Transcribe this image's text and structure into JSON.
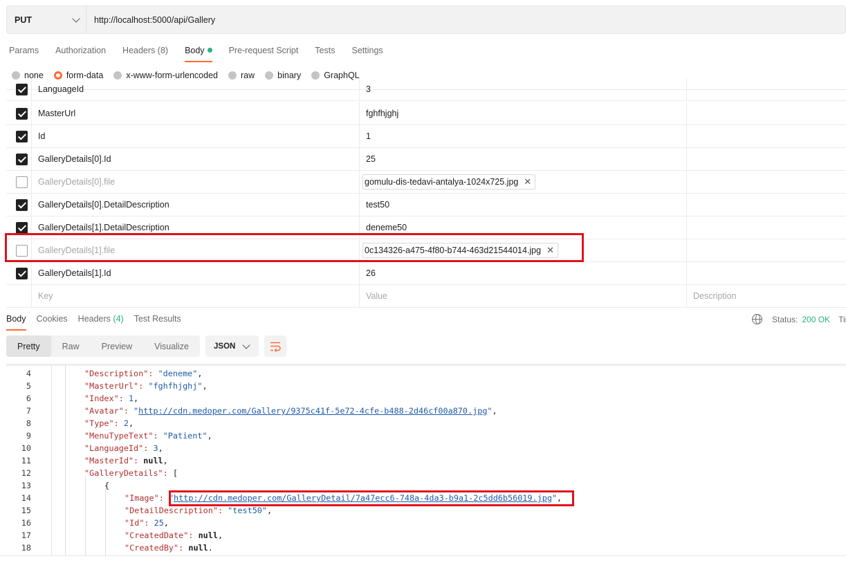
{
  "request": {
    "method": "PUT",
    "url": "http://localhost:5000/api/Gallery"
  },
  "request_tabs": [
    {
      "label": "Params"
    },
    {
      "label": "Authorization"
    },
    {
      "label": "Headers",
      "count": "(8)"
    },
    {
      "label": "Body"
    },
    {
      "label": "Pre-request Script"
    },
    {
      "label": "Tests"
    },
    {
      "label": "Settings"
    }
  ],
  "active_request_tab": "Body",
  "body_types": [
    "none",
    "form-data",
    "x-www-form-urlencoded",
    "raw",
    "binary",
    "GraphQL"
  ],
  "selected_body_type": "form-data",
  "form_rows": [
    {
      "checked": true,
      "key": "LanguageId",
      "value": "3",
      "type": "text"
    },
    {
      "checked": true,
      "key": "MasterUrl",
      "value": "fghfhjghj",
      "type": "text"
    },
    {
      "checked": true,
      "key": "Id",
      "value": "1",
      "type": "text"
    },
    {
      "checked": true,
      "key": "GalleryDetails[0].Id",
      "value": "25",
      "type": "text"
    },
    {
      "checked": false,
      "key": "GalleryDetails[0].file",
      "value": "gomulu-dis-tedavi-antalya-1024x725.jpg",
      "type": "file"
    },
    {
      "checked": true,
      "key": "GalleryDetails[0].DetailDescription",
      "value": "test50",
      "type": "text"
    },
    {
      "checked": true,
      "key": "GalleryDetails[1].DetailDescription",
      "value": "deneme50",
      "type": "text"
    },
    {
      "checked": false,
      "key": "GalleryDetails[1].file",
      "value": "0c134326-a475-4f80-b744-463d21544014.jpg",
      "type": "file"
    },
    {
      "checked": true,
      "key": "GalleryDetails[1].Id",
      "value": "26",
      "type": "text"
    }
  ],
  "new_row_placeholders": {
    "key": "Key",
    "value": "Value",
    "description": "Description"
  },
  "response_tabs": [
    {
      "label": "Body"
    },
    {
      "label": "Cookies"
    },
    {
      "label": "Headers",
      "count": "(4)"
    },
    {
      "label": "Test Results"
    }
  ],
  "status": {
    "label": "Status:",
    "value": "200 OK",
    "time_label": "Tim"
  },
  "view_modes": [
    "Pretty",
    "Raw",
    "Preview",
    "Visualize"
  ],
  "active_view_mode": "Pretty",
  "format": "JSON",
  "code_lines": [
    {
      "n": "4",
      "indent": 1,
      "key": "Description",
      "value": "deneme",
      "vtype": "string"
    },
    {
      "n": "5",
      "indent": 1,
      "key": "MasterUrl",
      "value": "fghfhjghj",
      "vtype": "string"
    },
    {
      "n": "6",
      "indent": 1,
      "key": "Index",
      "value": "1",
      "vtype": "number"
    },
    {
      "n": "7",
      "indent": 1,
      "key": "Avatar",
      "value": "http://cdn.medoper.com/Gallery/9375c41f-5e72-4cfe-b488-2d46cf00a870.jpg",
      "vtype": "link"
    },
    {
      "n": "8",
      "indent": 1,
      "key": "Type",
      "value": "2",
      "vtype": "number"
    },
    {
      "n": "9",
      "indent": 1,
      "key": "MenuTypeText",
      "value": "Patient",
      "vtype": "string"
    },
    {
      "n": "10",
      "indent": 1,
      "key": "LanguageId",
      "value": "3",
      "vtype": "number"
    },
    {
      "n": "11",
      "indent": 1,
      "key": "MasterId",
      "value": "null",
      "vtype": "keyword"
    },
    {
      "n": "12",
      "indent": 1,
      "key": "GalleryDetails",
      "value": "[",
      "vtype": "open"
    },
    {
      "n": "13",
      "indent": 2,
      "key": "",
      "value": "{",
      "vtype": "brace"
    },
    {
      "n": "14",
      "indent": 3,
      "key": "Image",
      "value": "http://cdn.medoper.com/GalleryDetail/7a47ecc6-748a-4da3-b9a1-2c5dd6b56019.jpg",
      "vtype": "link"
    },
    {
      "n": "15",
      "indent": 3,
      "key": "DetailDescription",
      "value": "test50",
      "vtype": "string"
    },
    {
      "n": "16",
      "indent": 3,
      "key": "Id",
      "value": "25",
      "vtype": "number"
    },
    {
      "n": "17",
      "indent": 3,
      "key": "CreatedDate",
      "value": "null",
      "vtype": "keyword"
    },
    {
      "n": "18",
      "indent": 3,
      "key": "CreatedBy",
      "value": "null",
      "vtype": "keyword"
    }
  ]
}
